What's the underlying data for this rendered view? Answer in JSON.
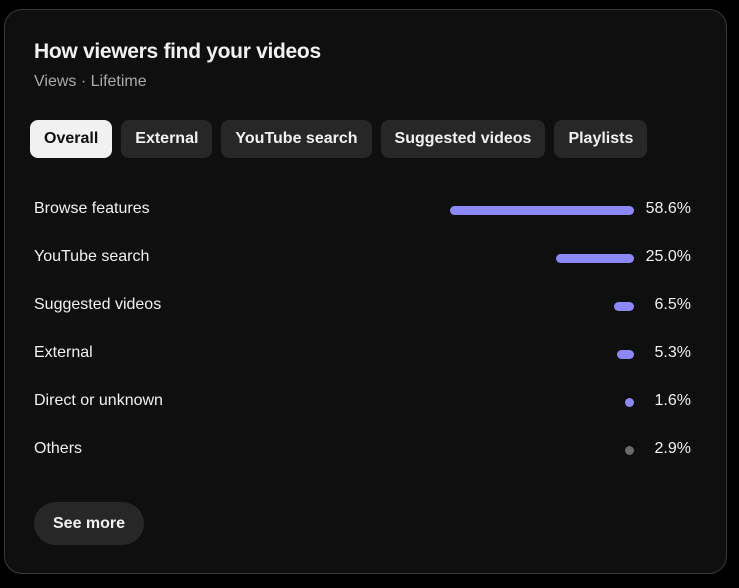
{
  "card": {
    "title": "How viewers find your videos",
    "subtitle": "Views · Lifetime"
  },
  "tabs": [
    {
      "label": "Overall",
      "active": true
    },
    {
      "label": "External",
      "active": false
    },
    {
      "label": "YouTube search",
      "active": false
    },
    {
      "label": "Suggested videos",
      "active": false
    },
    {
      "label": "Playlists",
      "active": false
    }
  ],
  "colors": {
    "bar": "#8c88f7",
    "bar_other": "#6b6b6b",
    "chip_active_bg": "#f1f1f1",
    "chip_bg": "#272727"
  },
  "sources": [
    {
      "label": "Browse features",
      "percent": 58.6,
      "value_text": "58.6%"
    },
    {
      "label": "YouTube search",
      "percent": 25.0,
      "value_text": "25.0%"
    },
    {
      "label": "Suggested videos",
      "percent": 6.5,
      "value_text": "6.5%"
    },
    {
      "label": "External",
      "percent": 5.3,
      "value_text": "5.3%"
    },
    {
      "label": "Direct or unknown",
      "percent": 1.6,
      "value_text": "1.6%"
    },
    {
      "label": "Others",
      "percent": 2.9,
      "value_text": "2.9%",
      "muted": true
    }
  ],
  "footer": {
    "see_more_label": "See more"
  }
}
